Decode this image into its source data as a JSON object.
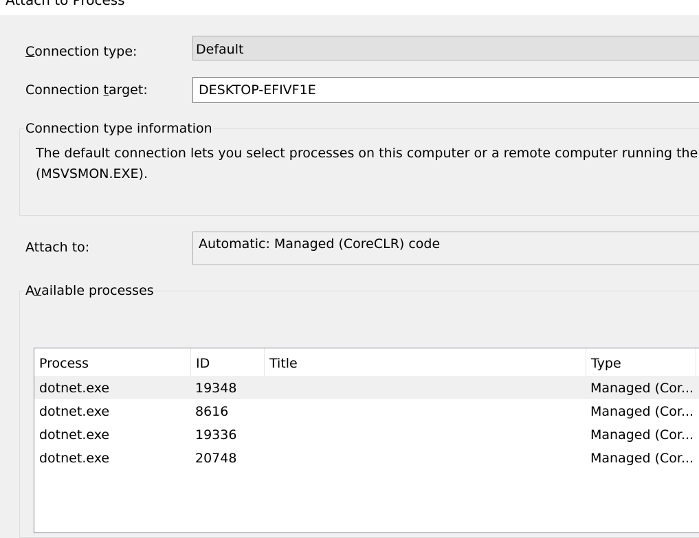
{
  "window": {
    "title": "Attach to Process"
  },
  "connection_type": {
    "label": "Connection type:",
    "accel": "C",
    "label_rest": "onnection type:",
    "value": "Default"
  },
  "connection_target": {
    "label_pre": "Connection ",
    "accel": "t",
    "label_post": "arget:",
    "value": "DESKTOP-EFIVF1E"
  },
  "connection_info": {
    "legend": "Connection type information",
    "line1": "The default connection lets you select processes on this computer or a remote computer running the Vis",
    "line2": "(MSVSMON.EXE)."
  },
  "attach_to": {
    "label": "Attach to:",
    "value": "Automatic: Managed (CoreCLR) code"
  },
  "available_processes": {
    "legend_pre": "A",
    "accel": "v",
    "legend_post": "ailable processes",
    "columns": {
      "process": "Process",
      "id": "ID",
      "title": "Title",
      "type": "Type"
    },
    "rows": [
      {
        "process": "dotnet.exe",
        "id": "19348",
        "title": "",
        "type": "Managed (Cor..."
      },
      {
        "process": "dotnet.exe",
        "id": "8616",
        "title": "",
        "type": "Managed (Cor..."
      },
      {
        "process": "dotnet.exe",
        "id": "19336",
        "title": "",
        "type": "Managed (Cor..."
      },
      {
        "process": "dotnet.exe",
        "id": "20748",
        "title": "",
        "type": "Managed (Cor..."
      }
    ]
  }
}
